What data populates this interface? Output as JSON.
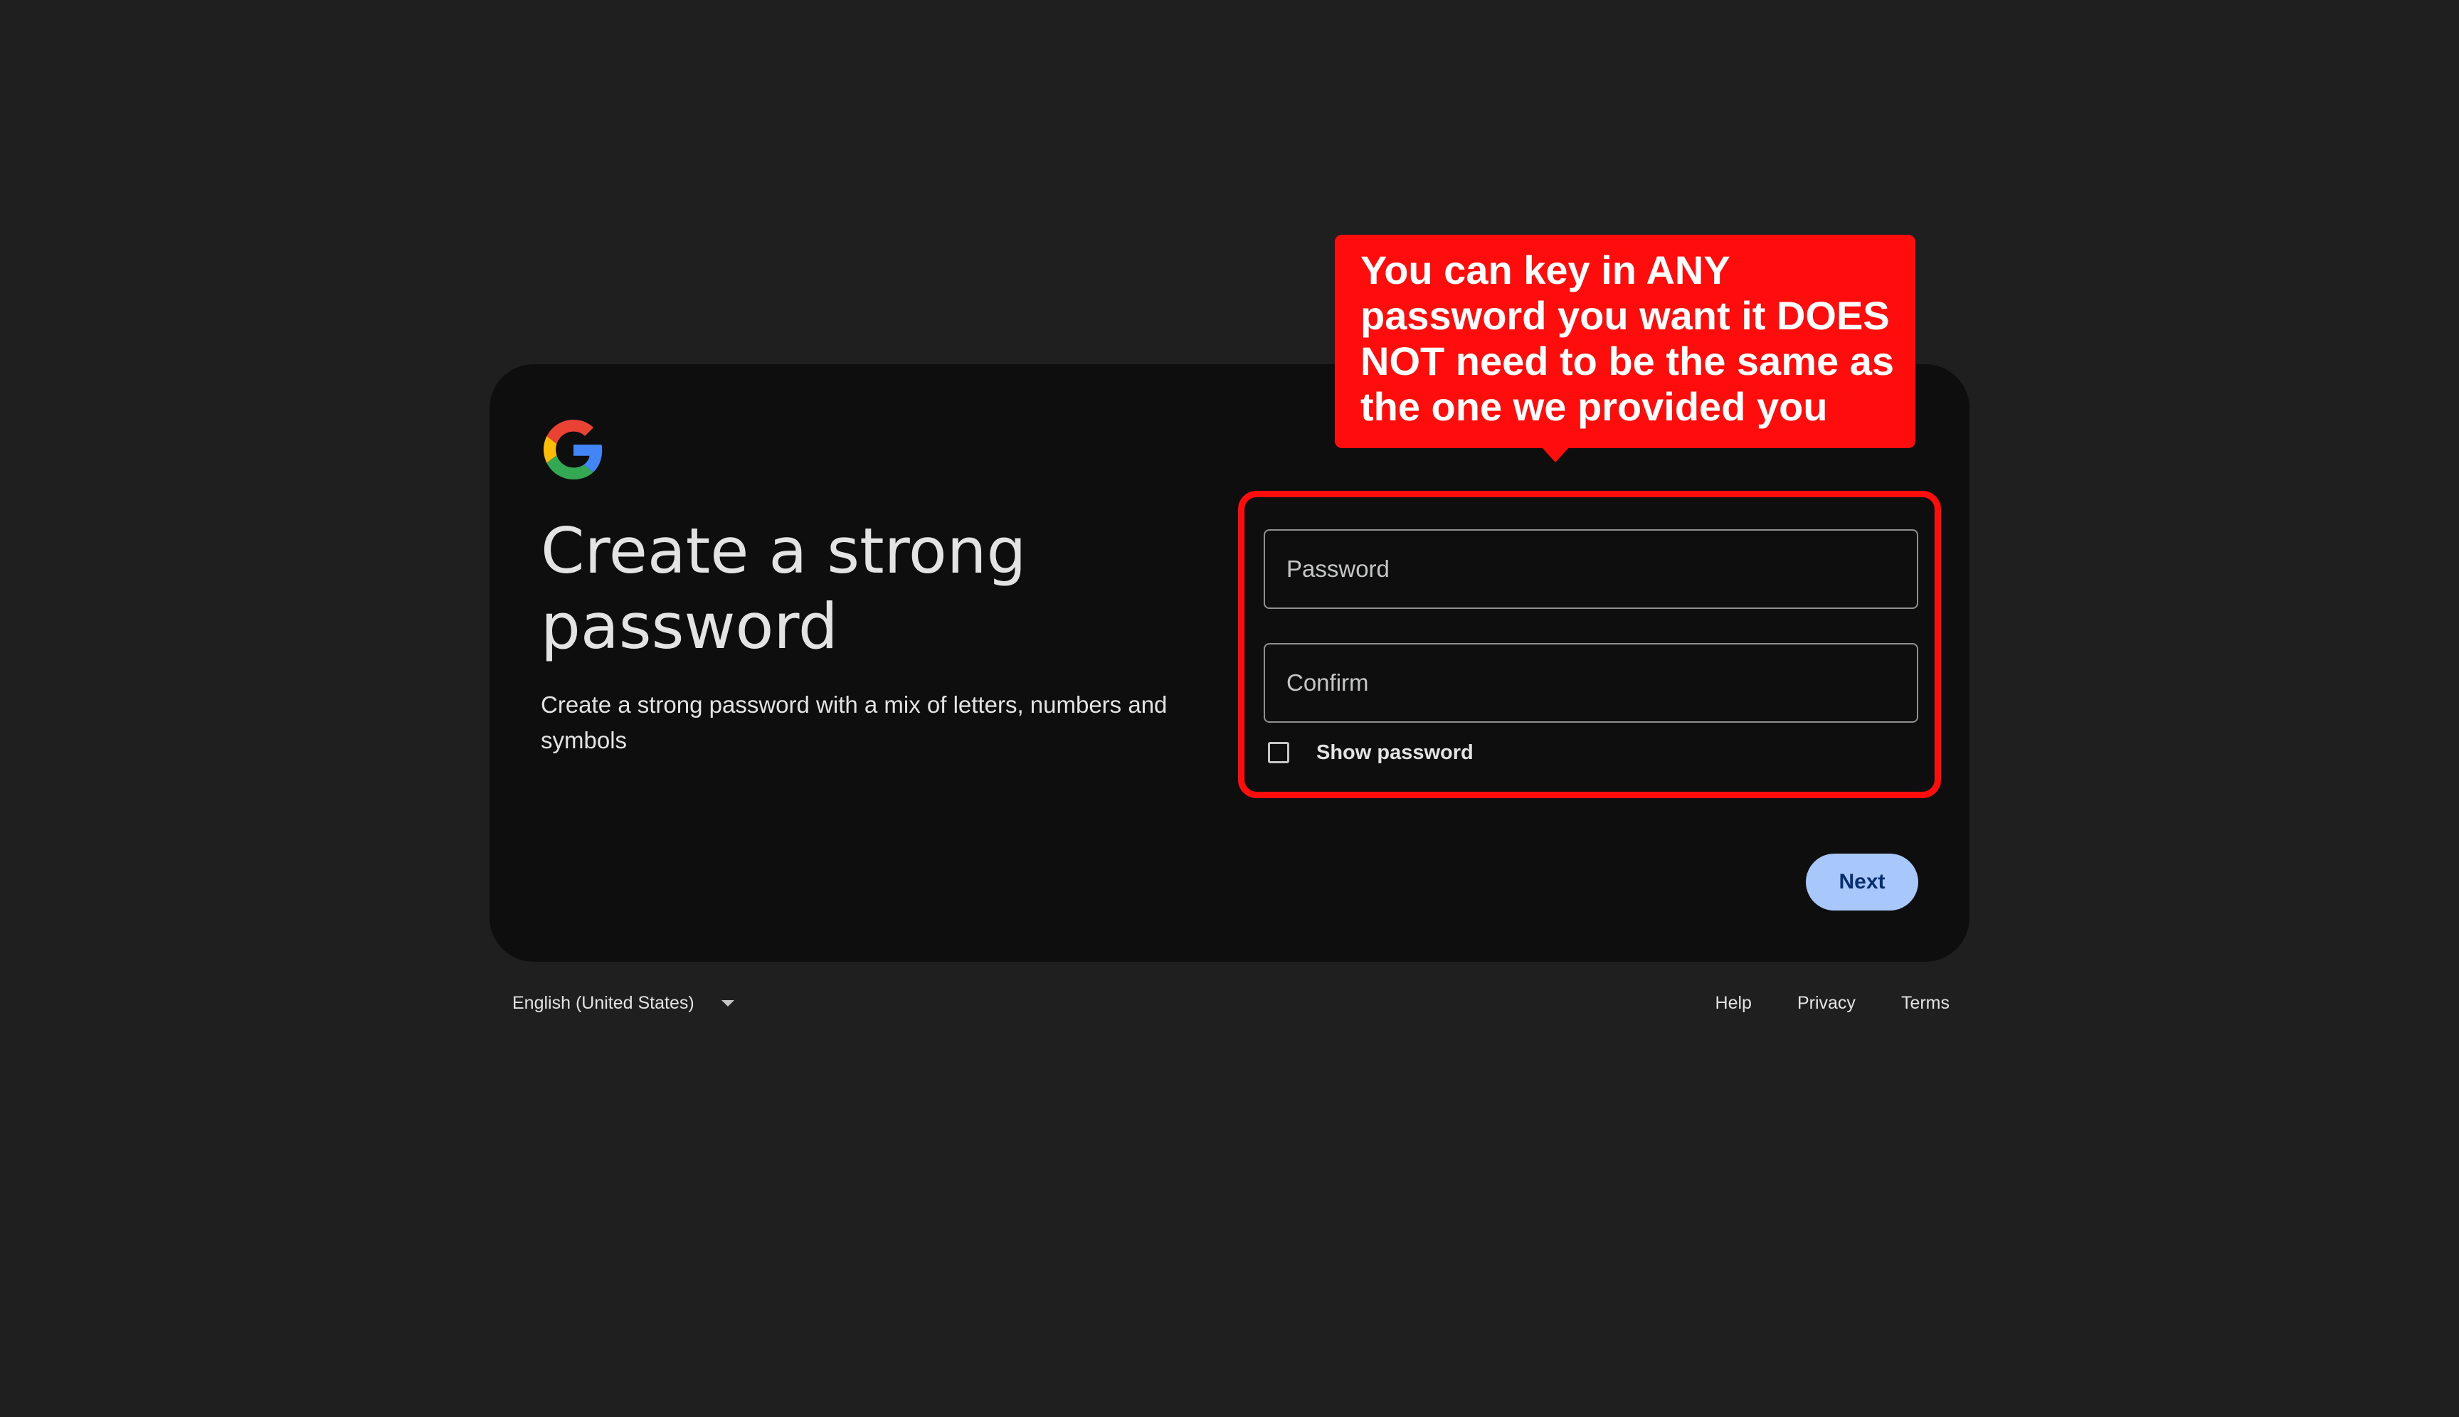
{
  "card": {
    "title": "Create a strong password",
    "subtitle": "Create a strong password with a mix of letters, numbers and symbols"
  },
  "logo": {
    "icon": "google-g-icon",
    "colors": {
      "blue": "#4285f4",
      "red": "#ea4335",
      "yellow": "#fbbc05",
      "green": "#34a853"
    }
  },
  "form": {
    "password_placeholder": "Password",
    "password_value": "",
    "confirm_placeholder": "Confirm",
    "confirm_value": "",
    "show_password_label": "Show password",
    "show_password_checked": false,
    "next_label": "Next"
  },
  "annotation": {
    "text": "You can key in ANY password you want it DOES NOT need to be the same as the one we provided you",
    "color": "#ff0d0d"
  },
  "footer": {
    "language": "English (United States)",
    "links": [
      "Help",
      "Privacy",
      "Terms"
    ]
  },
  "colors": {
    "page_background": "#1f1f1f",
    "card_background": "#0e0e0e",
    "primary_button": "#a8c7fa",
    "primary_button_text": "#062e6f"
  }
}
